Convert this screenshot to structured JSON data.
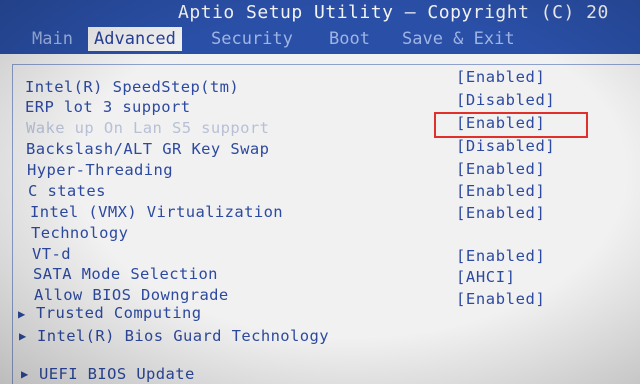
{
  "header": {
    "title": "Aptio Setup Utility – Copyright (C) 20"
  },
  "tabs": [
    {
      "label": "Main",
      "active": false
    },
    {
      "label": "Advanced",
      "active": true
    },
    {
      "label": "Security",
      "active": false
    },
    {
      "label": "Boot",
      "active": false
    },
    {
      "label": "Save & Exit",
      "active": false
    }
  ],
  "settings": [
    {
      "label": "Intel(R) SpeedStep(tm)",
      "value": "[Enabled]"
    },
    {
      "label": "ERP lot 3 support",
      "value": "[Disabled]"
    },
    {
      "label": "Wake up On Lan S5 support",
      "value": "[Enabled]",
      "selected": true
    },
    {
      "label": "Backslash/ALT GR Key Swap",
      "value": "[Disabled]"
    },
    {
      "label": "Hyper-Threading",
      "value": "[Enabled]"
    },
    {
      "label": "C states",
      "value": "[Enabled]"
    },
    {
      "label": "Intel (VMX) Virtualization",
      "value": "[Enabled]"
    },
    {
      "label": "Technology",
      "value": ""
    },
    {
      "label": "VT-d",
      "value": "[Enabled]"
    },
    {
      "label": "SATA Mode Selection",
      "value": "[AHCI]"
    },
    {
      "label": "Allow BIOS Downgrade",
      "value": "[Enabled]"
    }
  ],
  "submenus": [
    {
      "label": "Trusted Computing",
      "icon": "triangle-right-icon"
    },
    {
      "label": "Intel(R) Bios Guard Technology",
      "icon": "triangle-right-icon"
    },
    {
      "label": "UEFI BIOS Update",
      "icon": "triangle-right-icon"
    }
  ],
  "colors": {
    "header_blue": "#2a4fa6",
    "text_blue": "#2d4aa0",
    "panel_bg": "#f1f1f1",
    "highlight_red": "#e0302c"
  }
}
